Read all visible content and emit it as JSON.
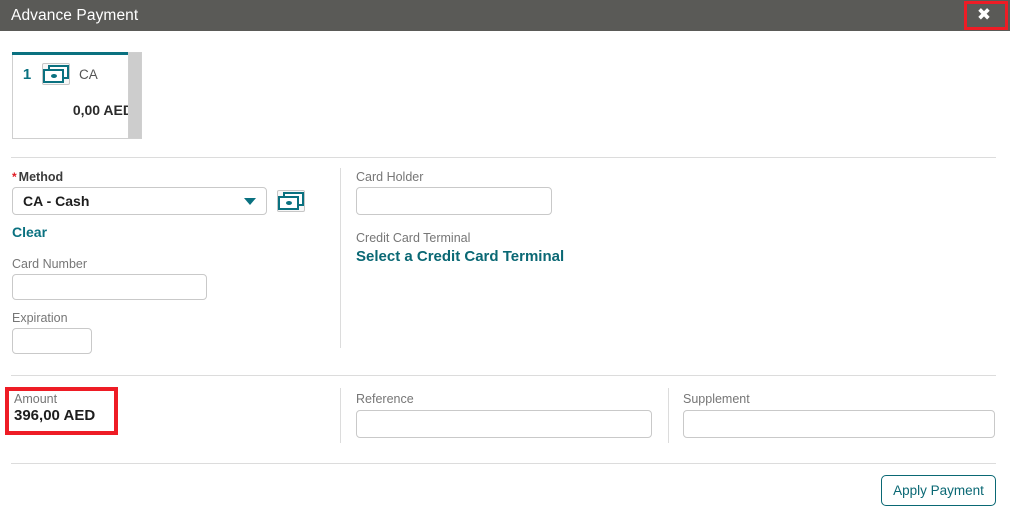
{
  "window": {
    "title": "Advance Payment",
    "close_icon": "close-icon",
    "titlebar_color": "#5a5a57",
    "accent_color": "#0a7180",
    "highlight_color": "#ee1c25"
  },
  "payment_lines": [
    {
      "sequence": "1",
      "method_code": "CA",
      "icon": "cash-icon",
      "amount": "0,00 AED"
    }
  ],
  "form": {
    "method": {
      "label": "Method",
      "required_marker": "*",
      "value": "CA - Cash",
      "caret_icon": "chevron-down-icon",
      "side_icon": "cash-icon"
    },
    "clear_link": "Clear",
    "card_number": {
      "label": "Card Number",
      "value": "",
      "placeholder": ""
    },
    "expiration": {
      "label": "Expiration",
      "value": "",
      "placeholder": ""
    },
    "card_holder": {
      "label": "Card Holder",
      "value": "",
      "placeholder": ""
    },
    "credit_card_terminal": {
      "label": "Credit Card Terminal",
      "link": "Select a Credit Card Terminal"
    }
  },
  "totals": {
    "amount": {
      "label": "Amount",
      "value": "396,00 AED"
    },
    "reference": {
      "label": "Reference",
      "value": "",
      "placeholder": ""
    },
    "supplement": {
      "label": "Supplement",
      "value": "",
      "placeholder": ""
    }
  },
  "footer": {
    "apply_button": "Apply Payment"
  }
}
